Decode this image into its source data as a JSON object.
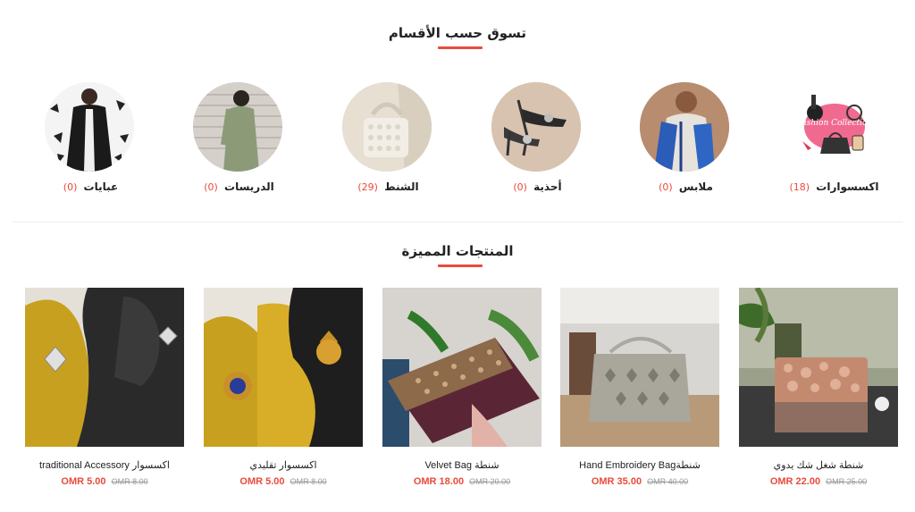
{
  "categories_section": {
    "title": "تسوق حسب الأقسام",
    "items": [
      {
        "name": "اكسسوارات",
        "count": "18",
        "image": "fashion-collection-illustration"
      },
      {
        "name": "ملابس",
        "count": "0",
        "image": "woman-blue-dress-photo"
      },
      {
        "name": "أحذية",
        "count": "0",
        "image": "heeled-shoes-photo"
      },
      {
        "name": "الشنط",
        "count": "29",
        "image": "pearl-bag-photo"
      },
      {
        "name": "الدريسات",
        "count": "0",
        "image": "woman-green-dress-photo"
      },
      {
        "name": "عبايات",
        "count": "0",
        "image": "woman-abaya-photo"
      }
    ],
    "fashion_logo_text": "Fashion Collection"
  },
  "featured_section": {
    "title": "المنتجات المميزة",
    "products": [
      {
        "name": "شنطة شغل شك يدوي",
        "price": "OMR 22.00",
        "old_price": "OMR 25.00"
      },
      {
        "name": "Hand Embroidery Bagشنطة",
        "price": "OMR 35.00",
        "old_price": "OMR 40.00"
      },
      {
        "name": "Velvet Bag شنطة",
        "price": "OMR 18.00",
        "old_price": "OMR 20.00"
      },
      {
        "name": "اكسسوار تقليدي",
        "price": "OMR 5.00",
        "old_price": "OMR 8.00"
      },
      {
        "name": "traditional Accessory اكسسوار",
        "price": "OMR 5.00",
        "old_price": "OMR 8.00"
      }
    ]
  },
  "colors": {
    "accent": "#e84b3c",
    "text": "#222222",
    "muted": "#999999"
  }
}
